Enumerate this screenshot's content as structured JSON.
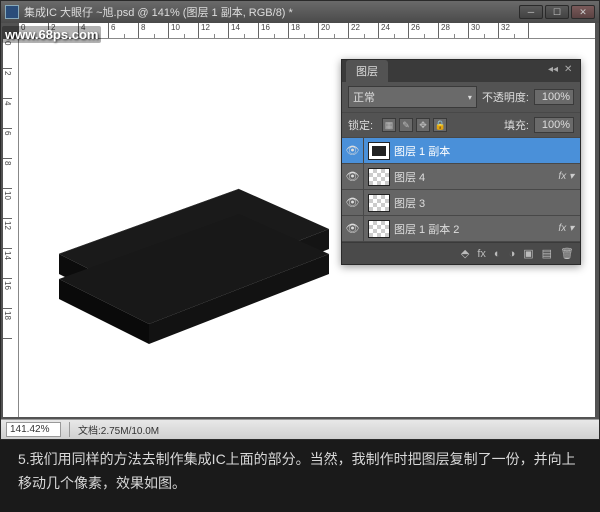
{
  "watermark": "www.68ps.com",
  "titlebar": {
    "text": "集成IC    大眼仔 ~旭.psd @ 141% (图层 1 副本, RGB/8) *"
  },
  "ruler_h": [
    "0",
    "2",
    "4",
    "6",
    "8",
    "10",
    "12",
    "14",
    "16",
    "18",
    "20",
    "22",
    "24",
    "26",
    "28",
    "30",
    "32"
  ],
  "ruler_v": [
    "0",
    "2",
    "4",
    "6",
    "8",
    "10",
    "12",
    "14",
    "16",
    "18"
  ],
  "statusbar": {
    "zoom": "141.42%",
    "doc": "文档:2.75M/10.0M"
  },
  "layers_panel": {
    "tab": "图层",
    "blend_mode": "正常",
    "opacity_label": "不透明度:",
    "opacity_value": "100%",
    "lock_label": "锁定:",
    "fill_label": "填充:",
    "fill_value": "100%",
    "items": [
      {
        "name": "图层 1 副本",
        "selected": true,
        "checker": false,
        "fx": false
      },
      {
        "name": "图层 4",
        "selected": false,
        "checker": true,
        "fx": true
      },
      {
        "name": "图层 3",
        "selected": false,
        "checker": true,
        "fx": false
      },
      {
        "name": "图层 1 副本 2",
        "selected": false,
        "checker": true,
        "fx": true
      }
    ]
  },
  "caption": "5.我们用同样的方法去制作集成IC上面的部分。当然，我制作时把图层复制了一份，并向上移动几个像素，效果如图。"
}
